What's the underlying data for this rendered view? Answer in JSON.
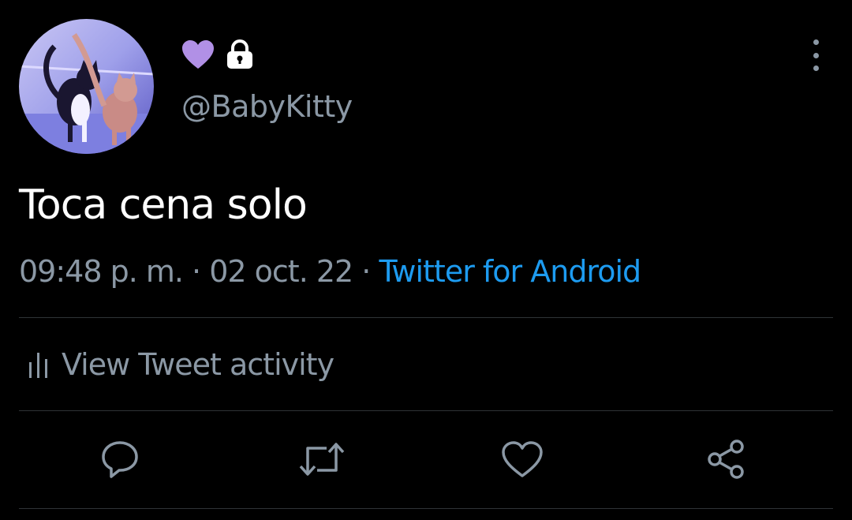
{
  "user": {
    "handle": "@BabyKitty",
    "badge_heart_color": "#b190e6",
    "avatar_description_icon": "avatar-cats-photo-icon",
    "protected_icon": "lock-icon"
  },
  "tweet": {
    "text": "Toca cena solo",
    "time": "09:48 p. m.",
    "date": "02 oct. 22",
    "separator": " · ",
    "source": "Twitter for Android"
  },
  "activity": {
    "label": "View Tweet activity",
    "icon": "bar-chart-icon"
  },
  "actions": [
    {
      "name": "reply",
      "icon": "reply-icon"
    },
    {
      "name": "retweet",
      "icon": "retweet-icon"
    },
    {
      "name": "like",
      "icon": "heart-icon"
    },
    {
      "name": "share",
      "icon": "share-icon"
    }
  ],
  "colors": {
    "background": "#000000",
    "text_primary": "#ffffff",
    "text_secondary": "#8b98a5",
    "link": "#1d9bf0",
    "divider": "#2f3336"
  }
}
